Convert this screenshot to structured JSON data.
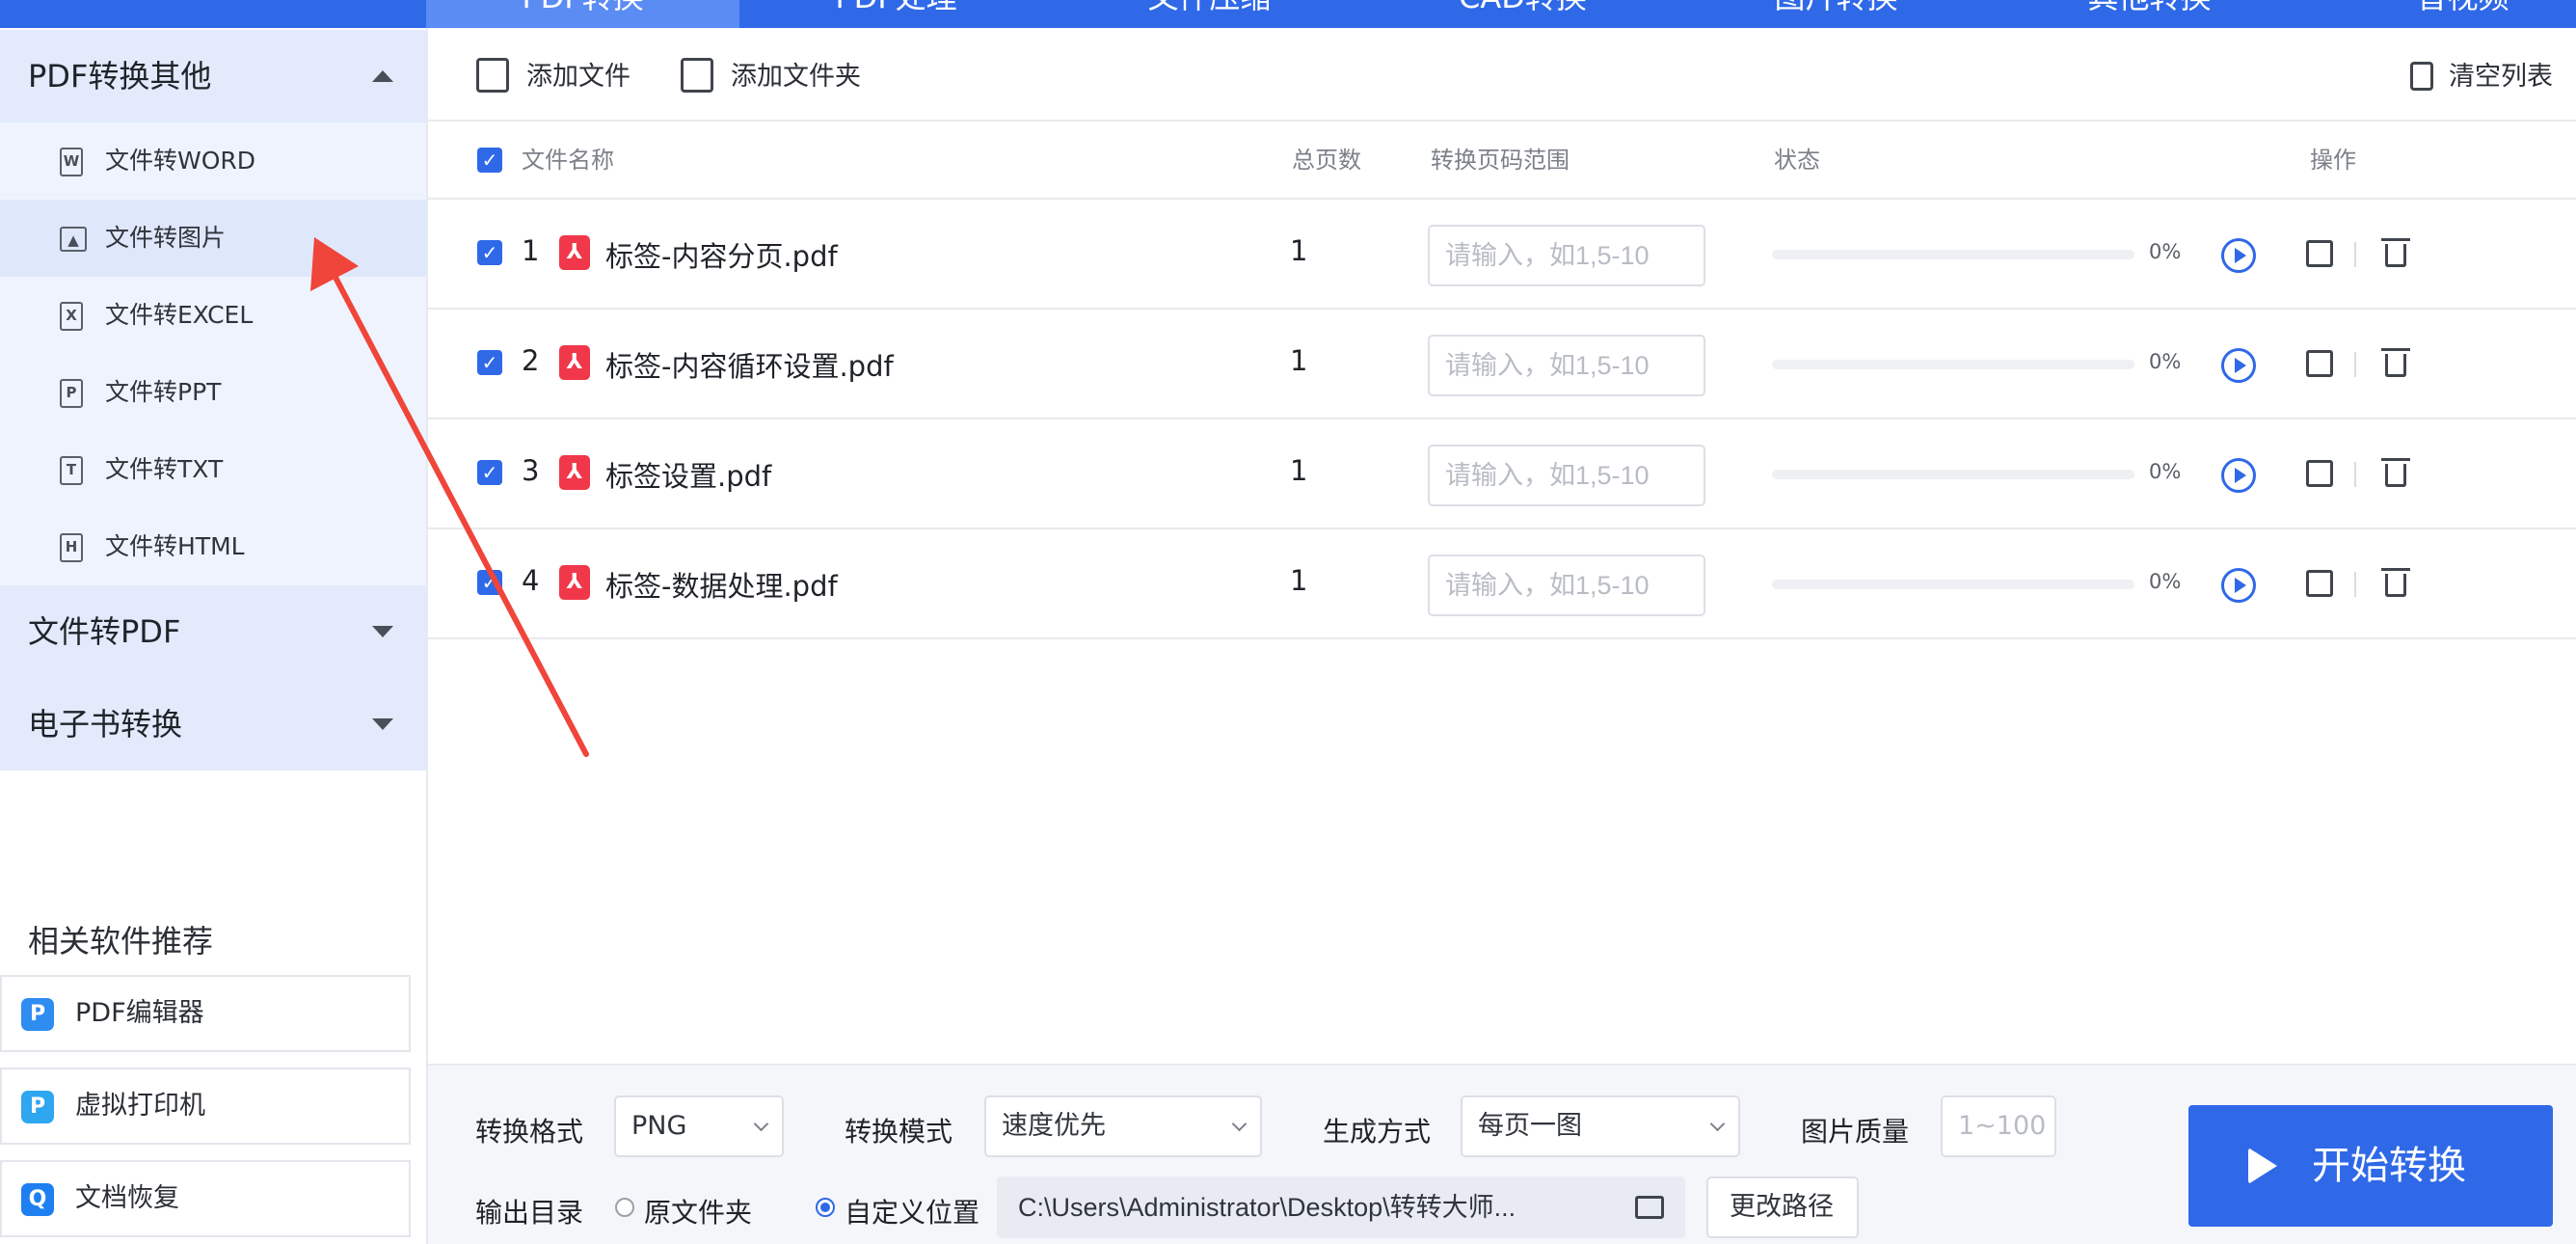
{
  "nav": {
    "tabs": [
      "PDF转换",
      "PDF处理",
      "文件压缩",
      "CAD转换",
      "图片转换",
      "其他转换",
      "音视频"
    ],
    "active_index": 0
  },
  "sidebar": {
    "pdf_to_other": {
      "title": "PDF转换其他",
      "items": [
        {
          "label": "文件转WORD",
          "icon": "W"
        },
        {
          "label": "文件转图片",
          "icon": "image"
        },
        {
          "label": "文件转EXCEL",
          "icon": "X"
        },
        {
          "label": "文件转PPT",
          "icon": "P"
        },
        {
          "label": "文件转TXT",
          "icon": "T"
        },
        {
          "label": "文件转HTML",
          "icon": "H"
        }
      ]
    },
    "file_to_pdf": "文件转PDF",
    "ebook": "电子书转换",
    "recommend_title": "相关软件推荐",
    "recommend": [
      {
        "label": "PDF编辑器",
        "color": "#2f8cf0"
      },
      {
        "label": "虚拟打印机",
        "color": "#2fa6f0"
      },
      {
        "label": "文档恢复",
        "color": "#1e7ff0"
      }
    ]
  },
  "toolbar": {
    "add_file": "添加文件",
    "add_folder": "添加文件夹",
    "clear_list": "清空列表"
  },
  "table": {
    "headers": {
      "name": "文件名称",
      "pages": "总页数",
      "range": "转换页码范围",
      "status": "状态",
      "ops": "操作"
    },
    "range_placeholder": "请输入，如1,5-10",
    "rows": [
      {
        "index": "1",
        "name": "标签-内容分页.pdf",
        "pages": "1",
        "progress": "0%"
      },
      {
        "index": "2",
        "name": "标签-内容循环设置.pdf",
        "pages": "1",
        "progress": "0%"
      },
      {
        "index": "3",
        "name": "标签设置.pdf",
        "pages": "1",
        "progress": "0%"
      },
      {
        "index": "4",
        "name": "标签-数据处理.pdf",
        "pages": "1",
        "progress": "0%"
      }
    ]
  },
  "settings": {
    "format_label": "转换格式",
    "format_value": "PNG",
    "mode_label": "转换模式",
    "mode_value": "速度优先",
    "gen_label": "生成方式",
    "gen_value": "每页一图",
    "quality_label": "图片质量",
    "quality_placeholder": "1~100",
    "output_label": "输出目录",
    "radio_original": "原文件夹",
    "radio_custom": "自定义位置",
    "output_path": "C:\\Users\\Administrator\\Desktop\\转转大师...",
    "change_path": "更改路径"
  },
  "start_button": "开始转换",
  "colors": {
    "accent": "#2f69e8",
    "arrow": "#f0453a",
    "pdf_icon": "#f0384a"
  }
}
